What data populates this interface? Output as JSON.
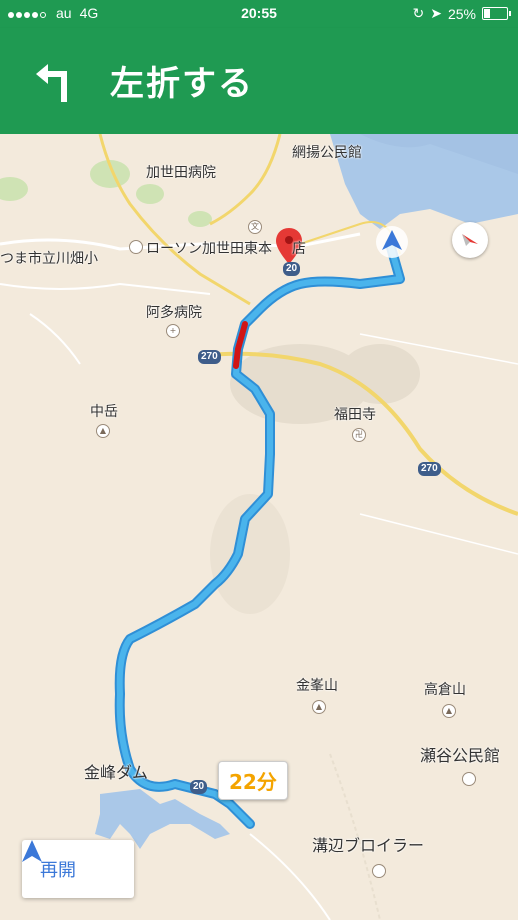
{
  "status_bar": {
    "carrier": "au",
    "network": "4G",
    "time": "20:55",
    "battery": "25%",
    "battery_level": 0.25
  },
  "navigation": {
    "instruction": "左折する",
    "turn_icon": "turn-left-icon"
  },
  "map": {
    "labels": {
      "amimoto_hall": "網揚公民館",
      "kaseda_hospital": "加世田病院",
      "tatsukawa": "つま市立川畑小",
      "lawson": "ローソン加世田東本",
      "lawson_suffix": "店",
      "ata_hospital": "阿多病院",
      "nakadake": "中岳",
      "fukudenji": "福田寺",
      "kanamine_mountain": "金峯山",
      "takakura": "高倉山",
      "seya_hall": "瀬谷公民館",
      "kanamine_dam": "金峰ダム",
      "mizobe": "溝辺ブロイラー"
    },
    "route_shields": [
      "20",
      "270",
      "270",
      "20"
    ]
  },
  "eta": "22分",
  "resume_button": {
    "label": "再開"
  },
  "colors": {
    "header": "#1f9a52",
    "route": "#4ab4ec",
    "eta": "#f4a400",
    "traffic": "#d01515"
  }
}
